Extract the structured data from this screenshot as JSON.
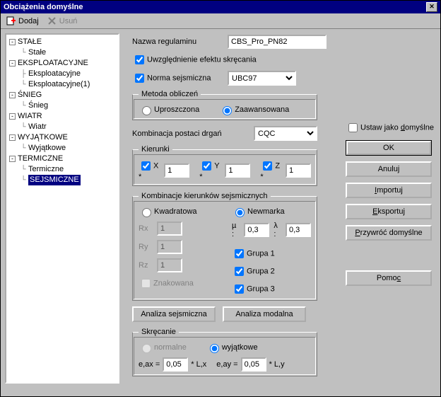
{
  "window": {
    "title": "Obciążenia domyślne"
  },
  "toolbar": {
    "add": "Dodaj",
    "remove": "Usuń"
  },
  "tree": {
    "n0": "STAŁE",
    "n0_0": "Stałe",
    "n1": "EKSPLOATACYJNE",
    "n1_0": "Eksploatacyjne",
    "n1_1": "Eksploatacyjne(1)",
    "n2": "ŚNIEG",
    "n2_0": "Śnieg",
    "n3": "WIATR",
    "n3_0": "Wiatr",
    "n4": "WYJĄTKOWE",
    "n4_0": "Wyjątkowe",
    "n5": "TERMICZNE",
    "n5_0": "Termiczne",
    "n6": "SEJSMICZNE"
  },
  "form": {
    "name_label": "Nazwa regulaminu",
    "name_value": "CBS_Pro_PN82",
    "twist_label": "Uwzględnienie efektu skręcania",
    "norm_label": "Norma sejsmiczna",
    "norm_value": "UBC97",
    "method_legend": "Metoda obliczeń",
    "method_simple": "Uproszczona",
    "method_adv": "Zaawansowana",
    "komb_label": "Kombinacja postaci drgań",
    "komb_value": "CQC",
    "kier_legend": "Kierunki",
    "x_label": "X *",
    "y_label": "Y *",
    "z_label": "Z *",
    "x_val": "1",
    "y_val": "1",
    "z_val": "1",
    "kks_legend": "Kombinacje kierunków sejsmicznych",
    "kwadr": "Kwadratowa",
    "newmark": "Newmarka",
    "rx": "Rx",
    "ry": "Ry",
    "rz": "Rz",
    "rx_v": "1",
    "ry_v": "1",
    "rz_v": "1",
    "znak": "Znakowana",
    "mu": "µ :",
    "mu_v": "0,3",
    "lam": "λ :",
    "lam_v": "0,3",
    "g1": "Grupa 1",
    "g2": "Grupa 2",
    "g3": "Grupa 3",
    "btn_seis": "Analiza sejsmiczna",
    "btn_modal": "Analiza modalna",
    "skr_legend": "Skręcanie",
    "skr_norm": "normalne",
    "skr_wyj": "wyjątkowe",
    "eax_label": "e,ax =",
    "eax_v": "0,05",
    "eax_suf": "* L,x",
    "eay_label": "e,ay =",
    "eay_v": "0,05",
    "eay_suf": "* L,y"
  },
  "side": {
    "set_default": "Ustaw jako ",
    "set_default_u": "d",
    "set_default2": "omyślne",
    "ok": "OK",
    "cancel": "Anuluj",
    "import1": "",
    "import_u": "I",
    "import2": "mportuj",
    "export1": "",
    "export_u": "E",
    "export2": "ksportuj",
    "restore1": "",
    "restore_u": "P",
    "restore2": "rzywróć domyślne",
    "help1": "Pomo",
    "help_u": "c",
    "help2": ""
  }
}
